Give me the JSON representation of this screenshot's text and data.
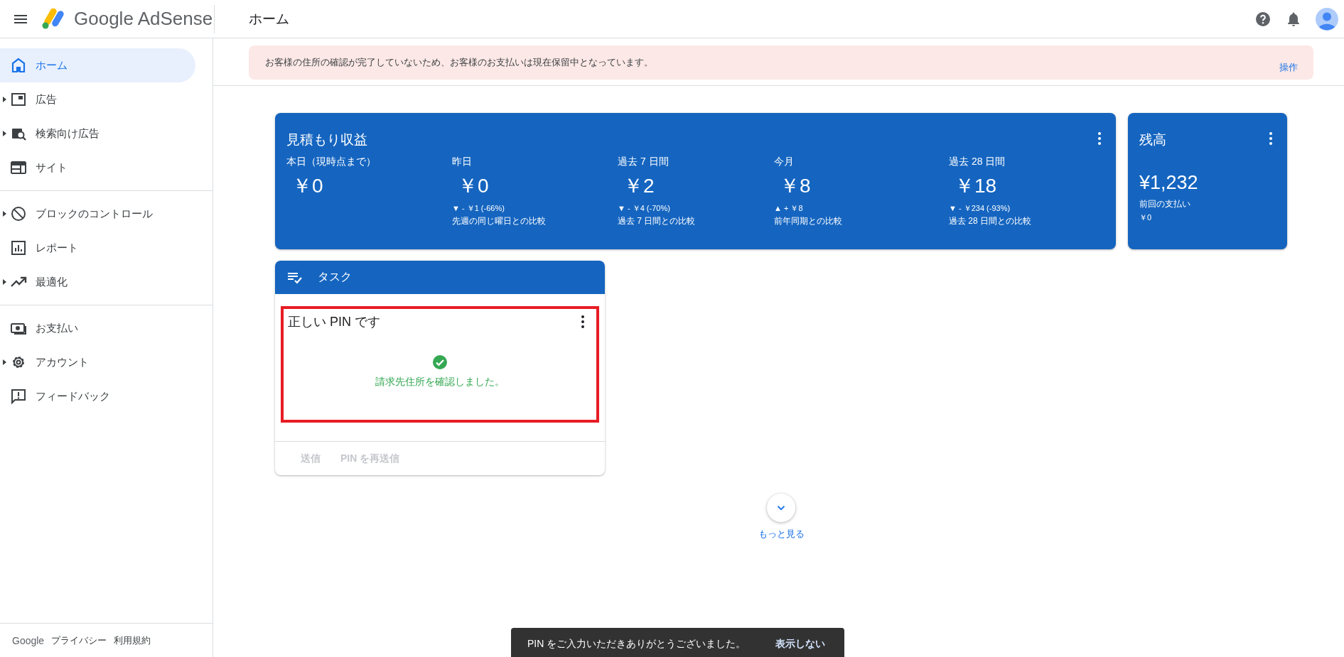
{
  "header": {
    "app_name": "Google AdSense",
    "page_title": "ホーム"
  },
  "sidebar": {
    "sections": [
      [
        {
          "label": "ホーム",
          "expandable": false,
          "selected": true
        },
        {
          "label": "広告",
          "expandable": true,
          "selected": false
        },
        {
          "label": "検索向け広告",
          "expandable": true,
          "selected": false
        },
        {
          "label": "サイト",
          "expandable": false,
          "selected": false
        }
      ],
      [
        {
          "label": "ブロックのコントロール",
          "expandable": true,
          "selected": false
        },
        {
          "label": "レポート",
          "expandable": false,
          "selected": false
        },
        {
          "label": "最適化",
          "expandable": true,
          "selected": false
        }
      ],
      [
        {
          "label": "お支払い",
          "expandable": false,
          "selected": false
        },
        {
          "label": "アカウント",
          "expandable": true,
          "selected": false
        },
        {
          "label": "フィードバック",
          "expandable": false,
          "selected": false
        }
      ]
    ],
    "footer": [
      "Google",
      "プライバシー",
      "利用規約"
    ]
  },
  "banner": {
    "message": "お客様の住所の確認が完了していないため、お客様のお支払いは現在保留中となっています。",
    "action": "操作"
  },
  "estimated_earnings": {
    "title": "見積もり収益",
    "metrics": [
      {
        "label": "本日（現時点まで）",
        "value": "￥0"
      },
      {
        "label": "昨日",
        "value": "￥0",
        "change": "▼ - ￥1 (-66%)",
        "comparison": "先週の同じ曜日との比較"
      },
      {
        "label": "過去 7 日間",
        "value": "￥2",
        "change": "▼ - ￥4 (-70%)",
        "comparison": "過去 7 日間との比較"
      },
      {
        "label": "今月",
        "value": "￥8",
        "change": "▲ + ￥8",
        "comparison": "前年同期との比較"
      },
      {
        "label": "過去 28 日間",
        "value": "￥18",
        "change": "▼ - ￥234 (-93%)",
        "comparison": "過去 28 日間との比較"
      }
    ]
  },
  "balance": {
    "title": "残高",
    "amount": "¥1,232",
    "last_payment_label": "前回の支払い",
    "last_payment_value": "￥0"
  },
  "tasks": {
    "title": "タスク",
    "task": {
      "title": "正しい PIN です",
      "message": "請求先住所を確認しました。",
      "highlighted": true
    },
    "buttons": [
      {
        "label": "送信",
        "disabled": true
      },
      {
        "label": "PIN を再送信",
        "disabled": true
      }
    ]
  },
  "more": {
    "label": "もっと見る"
  },
  "snackbar": {
    "message": "PIN をご入力いただきありがとうございました。",
    "action": "表示しない"
  }
}
